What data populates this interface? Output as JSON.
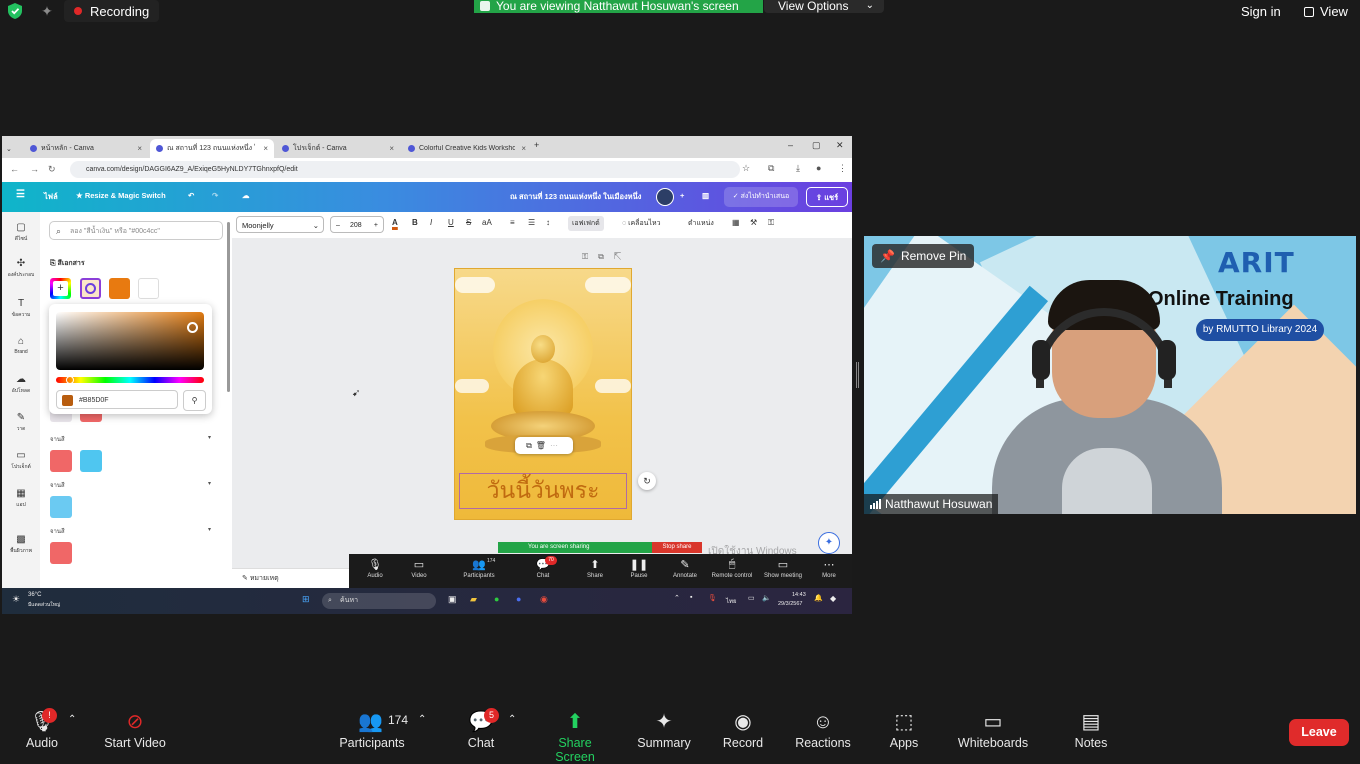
{
  "topbar": {
    "recording_label": "Recording",
    "viewing_banner": "You are viewing Natthawut Hosuwan's screen",
    "view_options_label": "View Options",
    "sign_in_label": "Sign in",
    "view_label": "View"
  },
  "shared_screen": {
    "browser_tabs": [
      {
        "label": "หน้าหลัก - Canva"
      },
      {
        "label": "ณ สถานที่ 123 ถนนแห่งหนึ่ง ในเมือง"
      },
      {
        "label": "โปรเจ็กต์ - Canva"
      },
      {
        "label": "Colorful Creative Kids Worksho"
      }
    ],
    "url": "canva.com/design/DAGGI6AZ9_A/ExiqeG5HyNLDY7TGhnxpfQ/edit",
    "canva_header": {
      "file_label": "ไฟล์",
      "resize_label": "Resize & Magic Switch",
      "doc_title": "ณ สถานที่ 123 ถนนแห่งหนึ่ง ในเมืองหนึ่ง",
      "present_label": "ส่งไปทำนำเสนอ",
      "share_label": "แชร์"
    },
    "left_rail": [
      {
        "label": "ดีไซน์"
      },
      {
        "label": "องค์ประกอบ"
      },
      {
        "label": "ข้อความ"
      },
      {
        "label": "Brand"
      },
      {
        "label": "อัปโหลด"
      },
      {
        "label": "วาด"
      },
      {
        "label": "โปรเจ็กต์"
      },
      {
        "label": "แอป"
      },
      {
        "label": "พื้นผิวภาพ"
      }
    ],
    "color_panel": {
      "search_placeholder": "ลอง \"สีน้ำเงิน\" หรือ \"#00c4cc\"",
      "doc_colors_title": "สีเอกสาร",
      "swatches": [
        "#B85D0F",
        "#FF6B6B",
        "#FFFFFF"
      ],
      "hex_value": "#B85D0F",
      "section_labels": [
        "จานสี",
        "จานสี",
        "จานสี"
      ]
    },
    "editor_toolbar": {
      "font_name": "Moonjelly",
      "font_size": "208",
      "effects_label": "เอฟเฟกต์",
      "animate_label": "เคลื่อนไหว",
      "position_label": "ตำแหน่ง"
    },
    "design_text": "วันนี้วันพระ",
    "notes_label": "หมายเหตุ",
    "screen_share_banner": "You are screen sharing",
    "stop_share_label": "Stop share",
    "zoom_controls": [
      {
        "label": "Audio"
      },
      {
        "label": "Video"
      },
      {
        "label": "Participants",
        "count": "174"
      },
      {
        "label": "Chat",
        "badge": "70"
      },
      {
        "label": "Share"
      },
      {
        "label": "Pause"
      },
      {
        "label": "Annotate"
      },
      {
        "label": "Remote control"
      },
      {
        "label": "Show meeting"
      },
      {
        "label": "More"
      }
    ],
    "watermark": "เปิดใช้งาน Windows",
    "taskbar": {
      "weather_temp": "36°C",
      "weather_desc": "มีแดดส่วนใหญ่",
      "search_placeholder": "ค้นหา",
      "lang": "ไทย",
      "time": "14:43",
      "date": "29/3/2567"
    }
  },
  "video": {
    "logo_text": "ARIT",
    "title": "Online Training",
    "byline": "by RMUTTO Library 2024",
    "pin_label": "Remove Pin",
    "participant_name": "Natthawut Hosuwan"
  },
  "bottombar": {
    "audio_label": "Audio",
    "audio_badge": "!",
    "start_video_label": "Start Video",
    "participants_label": "Participants",
    "participants_count": "174",
    "chat_label": "Chat",
    "chat_badge": "5",
    "share_screen_label": "Share Screen",
    "summary_label": "Summary",
    "record_label": "Record",
    "reactions_label": "Reactions",
    "apps_label": "Apps",
    "whiteboards_label": "Whiteboards",
    "notes_label": "Notes",
    "leave_label": "Leave"
  },
  "colors": {
    "share_green": "#23A447",
    "leave_red": "#E02B2B",
    "canva_gradient_start": "#0FB5C9",
    "canva_gradient_end": "#6B3FE0"
  }
}
